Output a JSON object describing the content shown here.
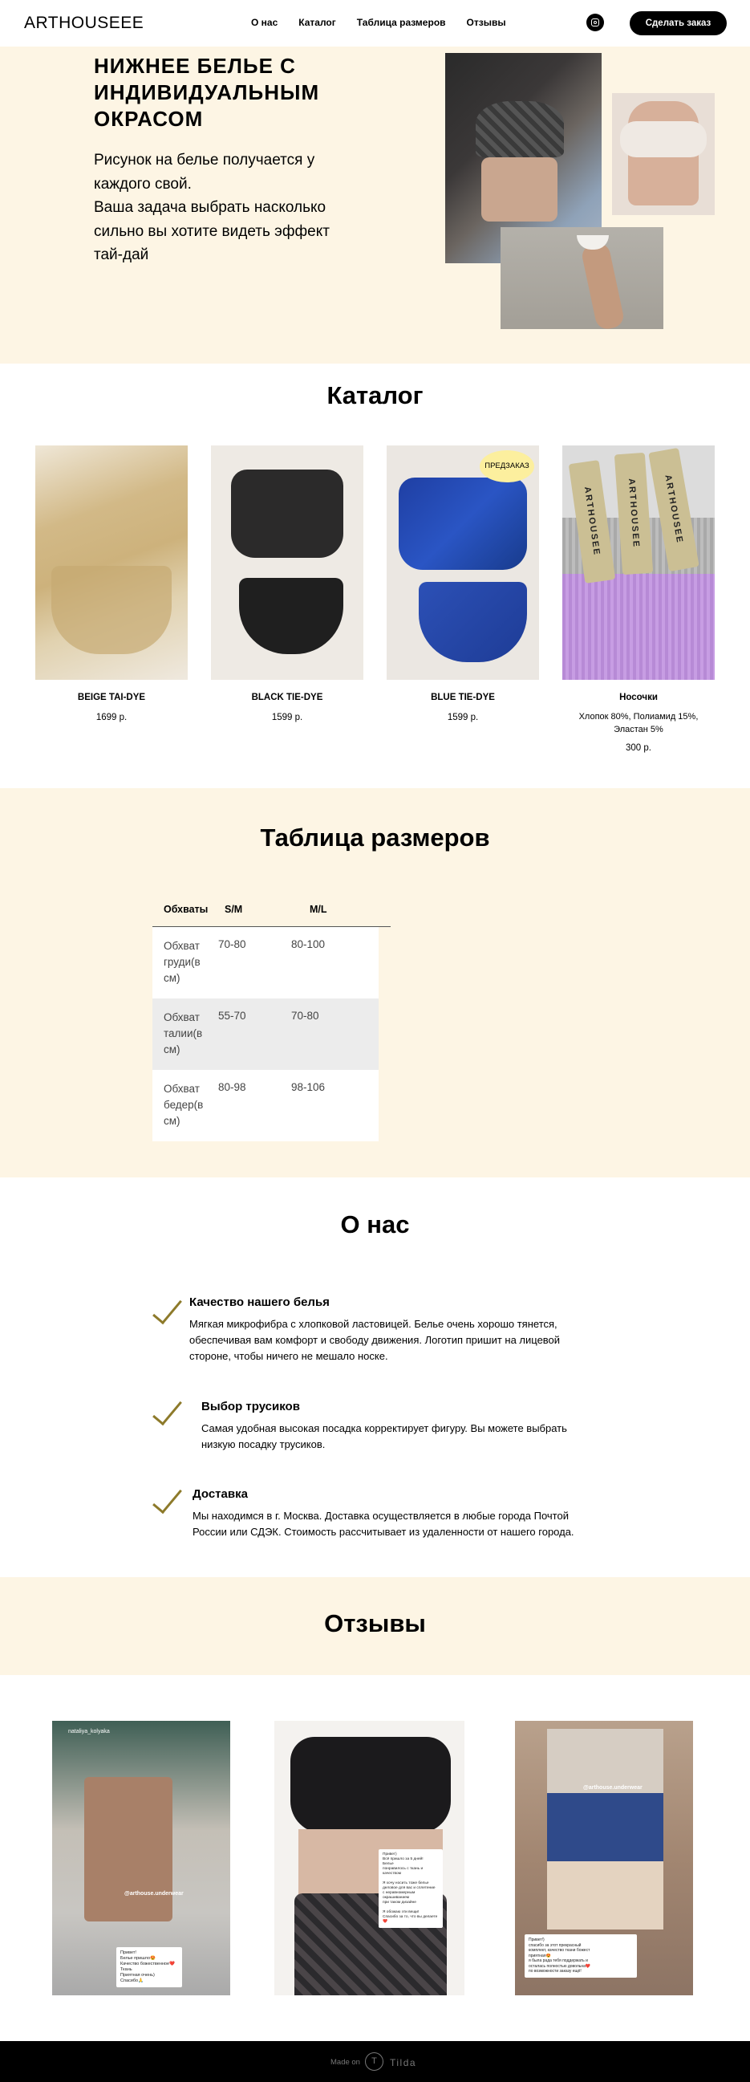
{
  "header": {
    "logo": "ARTHOUSEEE",
    "nav": [
      "О нас",
      "Каталог",
      "Таблица размеров",
      "Отзывы"
    ],
    "cta": "Сделать заказ",
    "instagram_icon": "instagram-icon"
  },
  "hero": {
    "title": "НИЖНЕЕ БЕЛЬЕ С ИНДИВИДУАЛЬНЫМ ОКРАСОМ",
    "text_line1": "Рисунок на белье получается у каждого свой.",
    "text_line2": "Ваша задача выбрать насколько сильно вы хотите видеть эффект тай-дай"
  },
  "catalog": {
    "title": "Каталог",
    "items": [
      {
        "name": "BEIGE TAI-DYE",
        "price": "1699 р."
      },
      {
        "name": "BLACK TIE-DYE",
        "price": "1599 р."
      },
      {
        "name": "BLUE TIE-DYE",
        "price": "1599 р.",
        "badge": "ПРЕДЗАКАЗ"
      },
      {
        "name": "Носочки",
        "desc": "Хлопок 80%, Полиамид 15%, Эластан 5%",
        "price": "300 р.",
        "tag": "ARTHOUSEE"
      }
    ]
  },
  "sizes": {
    "title": "Таблица размеров",
    "headers": [
      "Обхваты",
      "S/M",
      "M/L"
    ],
    "rows": [
      [
        "Обхват груди(в см)",
        "70-80",
        "80-100"
      ],
      [
        "Обхват талии(в см)",
        "55-70",
        "70-80"
      ],
      [
        "Обхват бедер(в см)",
        "80-98",
        "98-106"
      ]
    ]
  },
  "about": {
    "title": "О нас",
    "features": [
      {
        "title": "Качество нашего белья",
        "text": "Мягкая микрофибра с хлопковой ластовицей. Белье очень хорошо тянется, обеспечивая вам комфорт и свободу движения. Логотип пришит на лицевой стороне, чтобы ничего не мешало носке."
      },
      {
        "title": "Выбор трусиков",
        "text": "Самая удобная высокая посадка корректирует фигуру. Вы можете выбрать низкую посадку трусиков."
      },
      {
        "title": "Доставка",
        "text": "Мы находимся в г. Москва. Доставка осуществляется в любые города Почтой России или СДЭК. Стоимость рассчитывает из удаленности от нашего города."
      }
    ]
  },
  "reviews": {
    "title": "Отзывы",
    "items": [
      {
        "handle": "@arthouse.underwear",
        "user": "nataliya_kolyaka",
        "text": "Привет!\nБелье пришло😍\nКачество божественное❤️ Ткань\nПриятная очень)\nСпасибо🙏"
      },
      {
        "handle": "",
        "user": "",
        "text": "Привет)\nВсё пришло за 5 дней!\nБелье\nпонравилось с ткань и качеством\n\nЯ хочу носить тоже белье\nделовое для вас и сплетение\nс неравномерным окрашиванием\nпри таком дизайне\n\nЯ обожаю эти вещи!\nСпасибо за то, что вы делаете ❤️"
      },
      {
        "handle": "@arthouse.underwear",
        "user": "",
        "text": "Привет!)\nспасибо за этот прекрасный\nкомплект, качество ткани божест\nприятная😍\nя была рада тебя поддержать и\nосталась полностью довольна❤️\nпо возможности заказу ещё!"
      }
    ]
  },
  "footer": {
    "made_on": "Made on",
    "brand": "Tilda",
    "logo_letter": "T"
  }
}
